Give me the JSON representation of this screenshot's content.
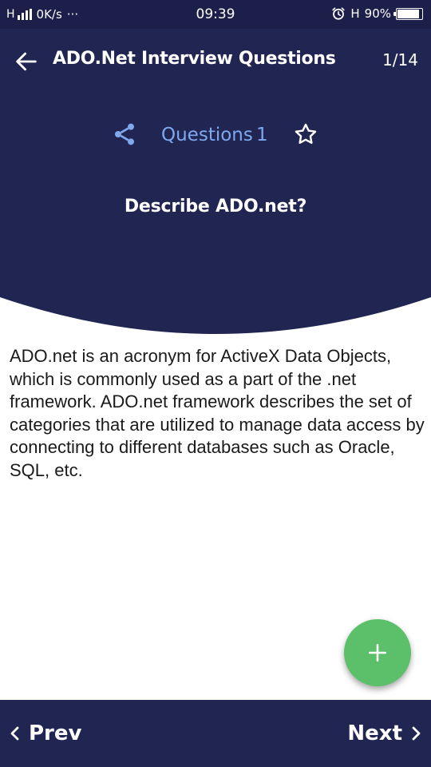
{
  "status_bar": {
    "network": "H",
    "speed": "0K/s",
    "more": "···",
    "time": "09:39",
    "network_type": "H",
    "battery": "90%",
    "battery_level": 0.9
  },
  "app_bar": {
    "title": "ADO.Net Interview Questions",
    "counter": "1/14"
  },
  "question": {
    "label": "Questions",
    "number": "1",
    "text": "Describe ADO.net?"
  },
  "answer": {
    "text": "ADO.net is an acronym for ActiveX Data Objects, which is commonly used as a part of the .net framework. ADO.net framework describes the set of categories that are utilized to manage data access by connecting to different databases such as Oracle, SQL, etc."
  },
  "nav": {
    "prev_label": "Prev",
    "next_label": "Next"
  },
  "colors": {
    "header": "#212552",
    "accent": "#7fa9ee",
    "fab": "#5cc06a"
  },
  "icons": {
    "back": "arrow-left-icon",
    "share": "share-icon",
    "star": "star-outline-icon",
    "add": "plus-icon",
    "prev": "chevron-left-icon",
    "next": "chevron-right-icon",
    "alarm": "alarm-icon"
  }
}
